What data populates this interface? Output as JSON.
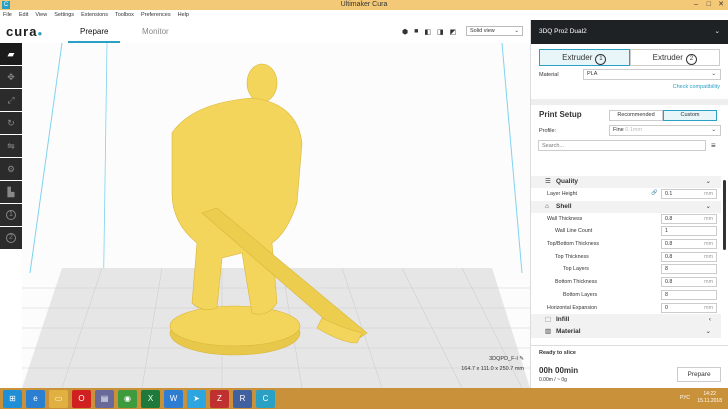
{
  "window": {
    "title": "Ultimaker Cura",
    "app_icon": "C"
  },
  "menu": [
    "File",
    "Edit",
    "View",
    "Settings",
    "Extensions",
    "Toolbox",
    "Preferences",
    "Help"
  ],
  "header": {
    "logo": "cura",
    "tabs": [
      "Prepare",
      "Monitor"
    ],
    "view_mode": "Solid view"
  },
  "left_tools": [
    "open-file",
    "move",
    "scale",
    "rotate",
    "mirror",
    "per-model-settings",
    "support-blocker"
  ],
  "extruder_buttons": [
    "1",
    "2"
  ],
  "object_info": {
    "name": "3DQPD_F-I",
    "dimensions": "164.7 x 111.0 x 250.7 mm"
  },
  "panel": {
    "machine": "3DQ Pro2 Dual2",
    "extruders": [
      {
        "label": "Extruder",
        "num": "1"
      },
      {
        "label": "Extruder",
        "num": "2"
      }
    ],
    "material_label": "Material",
    "material": "PLA",
    "check_link": "Check compatibility",
    "print_setup": "Print Setup",
    "modes": [
      "Recommended",
      "Custom"
    ],
    "profile_label": "Profile:",
    "profile": "Fine",
    "profile_sub": "0.1mm",
    "search_placeholder": "Search...",
    "categories": {
      "quality": "Quality",
      "shell": "Shell",
      "infill": "Infill",
      "material": "Material"
    },
    "settings": [
      {
        "name": "Layer Height",
        "value": "0.1",
        "unit": "mm",
        "indent": 0
      },
      {
        "name": "Wall Thickness",
        "value": "0.8",
        "unit": "mm",
        "indent": 0
      },
      {
        "name": "Wall Line Count",
        "value": "1",
        "unit": "",
        "indent": 1
      },
      {
        "name": "Top/Bottom Thickness",
        "value": "0.8",
        "unit": "mm",
        "indent": 0
      },
      {
        "name": "Top Thickness",
        "value": "0.8",
        "unit": "mm",
        "indent": 1
      },
      {
        "name": "Top Layers",
        "value": "8",
        "unit": "",
        "indent": 2
      },
      {
        "name": "Bottom Thickness",
        "value": "0.8",
        "unit": "mm",
        "indent": 1
      },
      {
        "name": "Bottom Layers",
        "value": "8",
        "unit": "",
        "indent": 2
      },
      {
        "name": "Horizontal Expansion",
        "value": "0",
        "unit": "mm",
        "indent": 0
      }
    ],
    "status": "Ready to slice",
    "time": "00h 00min",
    "material_usage": "0.00m / ~ 0g",
    "prepare_button": "Prepare"
  },
  "taskbar": {
    "lang": "РУС",
    "time": "14:22",
    "date": "15.11.2018"
  }
}
